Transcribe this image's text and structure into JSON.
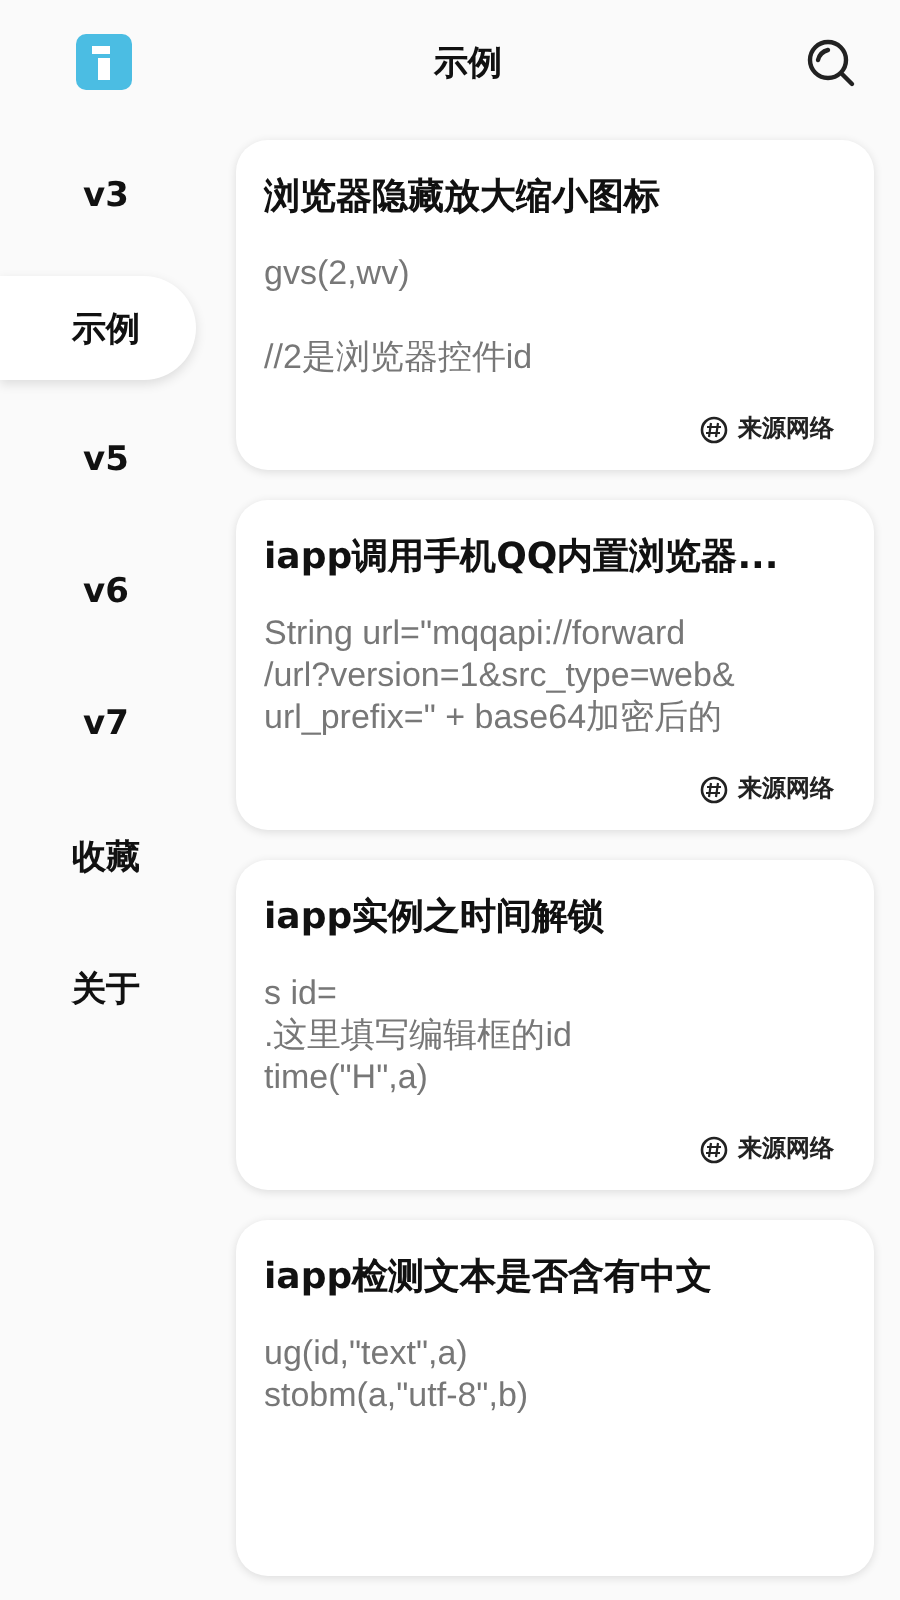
{
  "header": {
    "title": "示例"
  },
  "sidebar": {
    "items": [
      {
        "label": "v3",
        "selected": false
      },
      {
        "label": "示例",
        "selected": true
      },
      {
        "label": "v5",
        "selected": false
      },
      {
        "label": "v6",
        "selected": false
      },
      {
        "label": "v7",
        "selected": false
      },
      {
        "label": "收藏",
        "selected": false
      },
      {
        "label": "关于",
        "selected": false
      }
    ]
  },
  "cards": [
    {
      "title": "浏览器隐藏放大缩小图标",
      "body": "gvs(2,wv)\n\n//2是浏览器控件id",
      "source": "来源网络"
    },
    {
      "title": "iapp调用手机QQ内置浏览器...",
      "body": "String url=\"mqqapi://forward\n/url?version=1&src_type=web&\nurl_prefix=\" + base64加密后的",
      "source": "来源网络"
    },
    {
      "title": "iapp实例之时间解锁",
      "body": "s id=\n.这里填写编辑框的id\ntime(\"H\",a)",
      "source": "来源网络"
    },
    {
      "title": "iapp检测文本是否含有中文",
      "body": "ug(id,\"text\",a)\nstobm(a,\"utf-8\",b)"
    }
  ]
}
